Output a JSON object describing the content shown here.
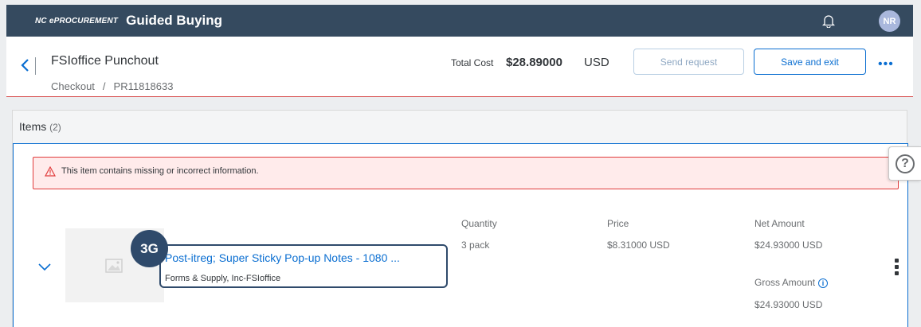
{
  "header": {
    "brand_small": "NC ePROCUREMENT",
    "brand_title": "Guided Buying",
    "avatar_initials": "NR"
  },
  "subheader": {
    "title": "FSIoffice Punchout",
    "breadcrumb": [
      "Checkout",
      "PR11818633"
    ],
    "breadcrumb_separator": "/",
    "total_label": "Total Cost",
    "total_value": "$28.89000",
    "total_currency": "USD",
    "send_request_label": "Send request",
    "save_exit_label": "Save and exit",
    "more_label": "•••"
  },
  "items": {
    "title": "Items",
    "count": "(2)",
    "error_message": "This item contains missing or incorrect information.",
    "item": {
      "badge": "3G",
      "name": "Post-itreg; Super Sticky Pop-up Notes - 1080 ...",
      "supplier": "Forms & Supply, Inc-FSIoffice",
      "quantity_label": "Quantity",
      "quantity_value": "3 pack",
      "price_label": "Price",
      "price_value": "$8.31000 USD",
      "net_label": "Net Amount",
      "net_value": "$24.93000 USD",
      "gross_label": "Gross Amount",
      "gross_value": "$24.93000 USD"
    }
  },
  "colors": {
    "header_bg": "#354a5f",
    "accent": "#0a6ed1",
    "error": "#e03b3b",
    "badge": "#2f4a6b"
  }
}
